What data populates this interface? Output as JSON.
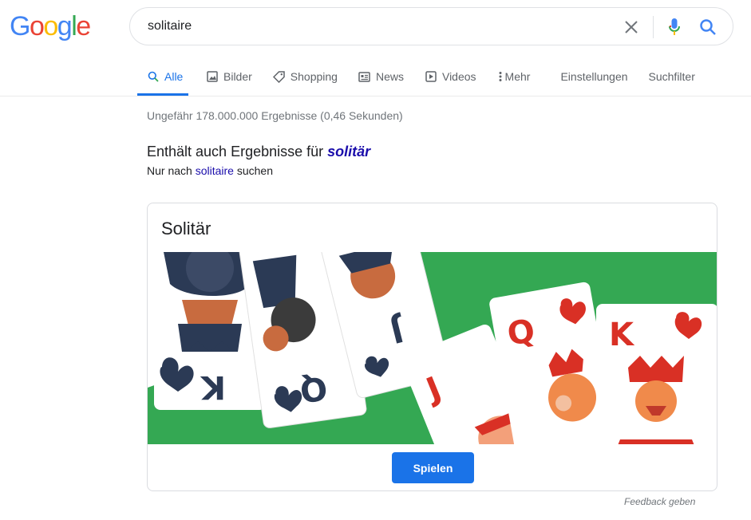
{
  "logo": {
    "letters": [
      "G",
      "o",
      "o",
      "g",
      "l",
      "e"
    ],
    "colors": [
      "#4285f4",
      "#ea4335",
      "#fbbc05",
      "#4285f4",
      "#34a853",
      "#ea4335"
    ]
  },
  "search": {
    "query": "solitaire"
  },
  "tabs": [
    {
      "label": "Alle",
      "icon": "search-icon"
    },
    {
      "label": "Bilder",
      "icon": "image-icon"
    },
    {
      "label": "Shopping",
      "icon": "tag-icon"
    },
    {
      "label": "News",
      "icon": "news-icon"
    },
    {
      "label": "Videos",
      "icon": "play-icon"
    },
    {
      "label": "Mehr",
      "icon": "more-vertical-icon"
    }
  ],
  "tools": {
    "settings": "Einstellungen",
    "filter": "Suchfilter"
  },
  "results": {
    "stats": "Ungefähr 178.000.000 Ergebnisse (0,46 Sekunden)"
  },
  "correction": {
    "prefix": "Enthält auch Ergebnisse für ",
    "corrected": "solitär",
    "only_prefix": "Nur nach ",
    "original": "solitaire",
    "only_suffix": " suchen"
  },
  "game_card": {
    "title": "Solitär",
    "play_label": "Spielen",
    "card_letters": [
      "K",
      "Q",
      "J",
      "J",
      "Q",
      "K"
    ]
  },
  "feedback": "Feedback geben",
  "colors": {
    "accent": "#1a73e8",
    "link": "#1a0dab",
    "felt_green": "#34a853",
    "card_red": "#d93025",
    "card_dark": "#2b3a55"
  }
}
